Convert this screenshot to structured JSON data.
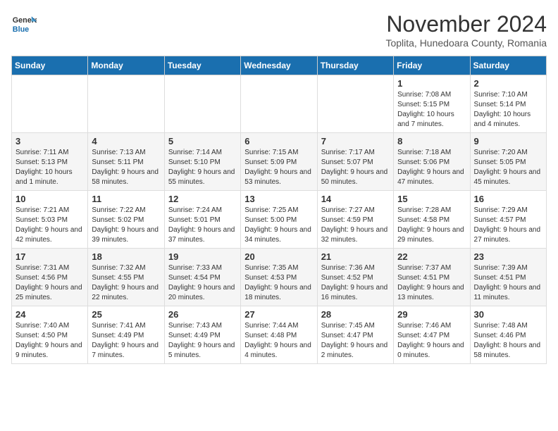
{
  "header": {
    "logo_general": "General",
    "logo_blue": "Blue",
    "title": "November 2024",
    "subtitle": "Toplita, Hunedoara County, Romania"
  },
  "weekdays": [
    "Sunday",
    "Monday",
    "Tuesday",
    "Wednesday",
    "Thursday",
    "Friday",
    "Saturday"
  ],
  "weeks": [
    [
      {
        "day": "",
        "detail": ""
      },
      {
        "day": "",
        "detail": ""
      },
      {
        "day": "",
        "detail": ""
      },
      {
        "day": "",
        "detail": ""
      },
      {
        "day": "",
        "detail": ""
      },
      {
        "day": "1",
        "detail": "Sunrise: 7:08 AM\nSunset: 5:15 PM\nDaylight: 10 hours and 7 minutes."
      },
      {
        "day": "2",
        "detail": "Sunrise: 7:10 AM\nSunset: 5:14 PM\nDaylight: 10 hours and 4 minutes."
      }
    ],
    [
      {
        "day": "3",
        "detail": "Sunrise: 7:11 AM\nSunset: 5:13 PM\nDaylight: 10 hours and 1 minute."
      },
      {
        "day": "4",
        "detail": "Sunrise: 7:13 AM\nSunset: 5:11 PM\nDaylight: 9 hours and 58 minutes."
      },
      {
        "day": "5",
        "detail": "Sunrise: 7:14 AM\nSunset: 5:10 PM\nDaylight: 9 hours and 55 minutes."
      },
      {
        "day": "6",
        "detail": "Sunrise: 7:15 AM\nSunset: 5:09 PM\nDaylight: 9 hours and 53 minutes."
      },
      {
        "day": "7",
        "detail": "Sunrise: 7:17 AM\nSunset: 5:07 PM\nDaylight: 9 hours and 50 minutes."
      },
      {
        "day": "8",
        "detail": "Sunrise: 7:18 AM\nSunset: 5:06 PM\nDaylight: 9 hours and 47 minutes."
      },
      {
        "day": "9",
        "detail": "Sunrise: 7:20 AM\nSunset: 5:05 PM\nDaylight: 9 hours and 45 minutes."
      }
    ],
    [
      {
        "day": "10",
        "detail": "Sunrise: 7:21 AM\nSunset: 5:03 PM\nDaylight: 9 hours and 42 minutes."
      },
      {
        "day": "11",
        "detail": "Sunrise: 7:22 AM\nSunset: 5:02 PM\nDaylight: 9 hours and 39 minutes."
      },
      {
        "day": "12",
        "detail": "Sunrise: 7:24 AM\nSunset: 5:01 PM\nDaylight: 9 hours and 37 minutes."
      },
      {
        "day": "13",
        "detail": "Sunrise: 7:25 AM\nSunset: 5:00 PM\nDaylight: 9 hours and 34 minutes."
      },
      {
        "day": "14",
        "detail": "Sunrise: 7:27 AM\nSunset: 4:59 PM\nDaylight: 9 hours and 32 minutes."
      },
      {
        "day": "15",
        "detail": "Sunrise: 7:28 AM\nSunset: 4:58 PM\nDaylight: 9 hours and 29 minutes."
      },
      {
        "day": "16",
        "detail": "Sunrise: 7:29 AM\nSunset: 4:57 PM\nDaylight: 9 hours and 27 minutes."
      }
    ],
    [
      {
        "day": "17",
        "detail": "Sunrise: 7:31 AM\nSunset: 4:56 PM\nDaylight: 9 hours and 25 minutes."
      },
      {
        "day": "18",
        "detail": "Sunrise: 7:32 AM\nSunset: 4:55 PM\nDaylight: 9 hours and 22 minutes."
      },
      {
        "day": "19",
        "detail": "Sunrise: 7:33 AM\nSunset: 4:54 PM\nDaylight: 9 hours and 20 minutes."
      },
      {
        "day": "20",
        "detail": "Sunrise: 7:35 AM\nSunset: 4:53 PM\nDaylight: 9 hours and 18 minutes."
      },
      {
        "day": "21",
        "detail": "Sunrise: 7:36 AM\nSunset: 4:52 PM\nDaylight: 9 hours and 16 minutes."
      },
      {
        "day": "22",
        "detail": "Sunrise: 7:37 AM\nSunset: 4:51 PM\nDaylight: 9 hours and 13 minutes."
      },
      {
        "day": "23",
        "detail": "Sunrise: 7:39 AM\nSunset: 4:51 PM\nDaylight: 9 hours and 11 minutes."
      }
    ],
    [
      {
        "day": "24",
        "detail": "Sunrise: 7:40 AM\nSunset: 4:50 PM\nDaylight: 9 hours and 9 minutes."
      },
      {
        "day": "25",
        "detail": "Sunrise: 7:41 AM\nSunset: 4:49 PM\nDaylight: 9 hours and 7 minutes."
      },
      {
        "day": "26",
        "detail": "Sunrise: 7:43 AM\nSunset: 4:49 PM\nDaylight: 9 hours and 5 minutes."
      },
      {
        "day": "27",
        "detail": "Sunrise: 7:44 AM\nSunset: 4:48 PM\nDaylight: 9 hours and 4 minutes."
      },
      {
        "day": "28",
        "detail": "Sunrise: 7:45 AM\nSunset: 4:47 PM\nDaylight: 9 hours and 2 minutes."
      },
      {
        "day": "29",
        "detail": "Sunrise: 7:46 AM\nSunset: 4:47 PM\nDaylight: 9 hours and 0 minutes."
      },
      {
        "day": "30",
        "detail": "Sunrise: 7:48 AM\nSunset: 4:46 PM\nDaylight: 8 hours and 58 minutes."
      }
    ]
  ]
}
